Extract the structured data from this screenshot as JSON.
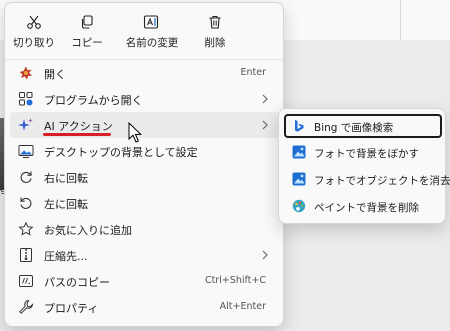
{
  "quick_actions": [
    {
      "label": "切り取り",
      "icon": "cut-icon"
    },
    {
      "label": "コピー",
      "icon": "copy-icon"
    },
    {
      "label": "名前の変更",
      "icon": "rename-icon"
    },
    {
      "label": "削除",
      "icon": "delete-icon"
    }
  ],
  "menu": {
    "items": [
      {
        "label": "開く",
        "shortcut": "Enter",
        "icon": "open-icon"
      },
      {
        "label": "プログラムから開く",
        "has_submenu": true,
        "icon": "open-with-icon"
      },
      {
        "label": "AI アクション",
        "has_submenu": true,
        "icon": "ai-sparkle-icon"
      },
      {
        "label": "デスクトップの背景として設定",
        "icon": "desktop-background-icon"
      },
      {
        "label": "右に回転",
        "icon": "rotate-right-icon"
      },
      {
        "label": "左に回転",
        "icon": "rotate-left-icon"
      },
      {
        "label": "お気に入りに追加",
        "icon": "star-icon"
      },
      {
        "label": "圧縮先...",
        "has_submenu": true,
        "icon": "zip-icon"
      },
      {
        "label": "パスのコピー",
        "shortcut": "Ctrl+Shift+C",
        "icon": "copy-path-icon"
      },
      {
        "label": "プロパティ",
        "shortcut": "Alt+Enter",
        "icon": "properties-icon"
      }
    ]
  },
  "submenu": {
    "items": [
      {
        "label": "Bing で画像検索",
        "icon": "bing-icon"
      },
      {
        "label": "フォトで背景をぼかす",
        "icon": "photos-icon"
      },
      {
        "label": "フォトでオブジェクトを消去",
        "icon": "photos-icon"
      },
      {
        "label": "ペイントで背景を削除",
        "icon": "paint-icon"
      }
    ]
  },
  "colors": {
    "accent_underline": "#d6202a",
    "bing_blue": "#1f6fd6",
    "photos_blue": "#1d6fd1"
  }
}
